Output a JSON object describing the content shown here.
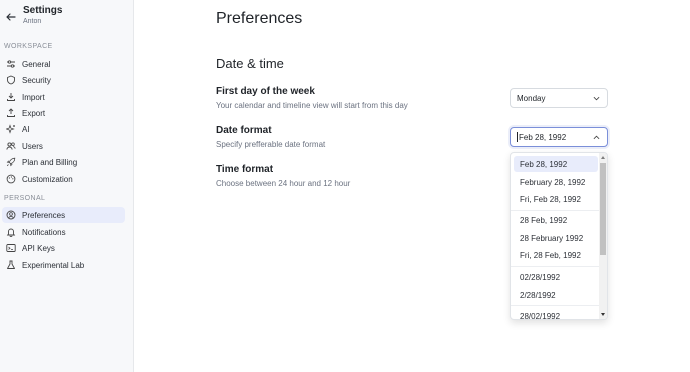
{
  "sidebar": {
    "title": "Settings",
    "user": "Anton",
    "workspace_label": "Workspace",
    "personal_label": "Personal",
    "workspace_items": [
      {
        "label": "General",
        "icon": "sliders-icon"
      },
      {
        "label": "Security",
        "icon": "shield-icon"
      },
      {
        "label": "Import",
        "icon": "import-icon"
      },
      {
        "label": "Export",
        "icon": "export-icon"
      },
      {
        "label": "AI",
        "icon": "sparkle-icon"
      },
      {
        "label": "Users",
        "icon": "users-icon"
      },
      {
        "label": "Plan and Billing",
        "icon": "rocket-icon"
      },
      {
        "label": "Customization",
        "icon": "palette-icon"
      }
    ],
    "personal_items": [
      {
        "label": "Preferences",
        "icon": "user-circle-icon",
        "active": true
      },
      {
        "label": "Notifications",
        "icon": "bell-icon"
      },
      {
        "label": "API Keys",
        "icon": "terminal-icon"
      },
      {
        "label": "Experimental Lab",
        "icon": "flask-icon"
      }
    ]
  },
  "main": {
    "title": "Preferences",
    "section_title": "Date & time",
    "first_day": {
      "title": "First day of the week",
      "description": "Your calendar and timeline view will start from this day",
      "value": "Monday"
    },
    "date_format": {
      "title": "Date format",
      "description": "Specify prefferable date format",
      "value": "Feb 28, 1992",
      "options": [
        "Feb 28, 1992",
        "February 28, 1992",
        "Fri, Feb 28, 1992",
        "28 Feb, 1992",
        "28 February 1992",
        "Fri, 28 Feb, 1992",
        "02/28/1992",
        "2/28/1992",
        "28/02/1992"
      ],
      "selected_index": 0
    },
    "time_format": {
      "title": "Time format",
      "description": "Choose between 24 hour and 12 hour"
    }
  },
  "colors": {
    "accent": "#7b8fd9",
    "active_bg": "#e8ecfb",
    "sidebar_bg": "#f7f8fa"
  }
}
